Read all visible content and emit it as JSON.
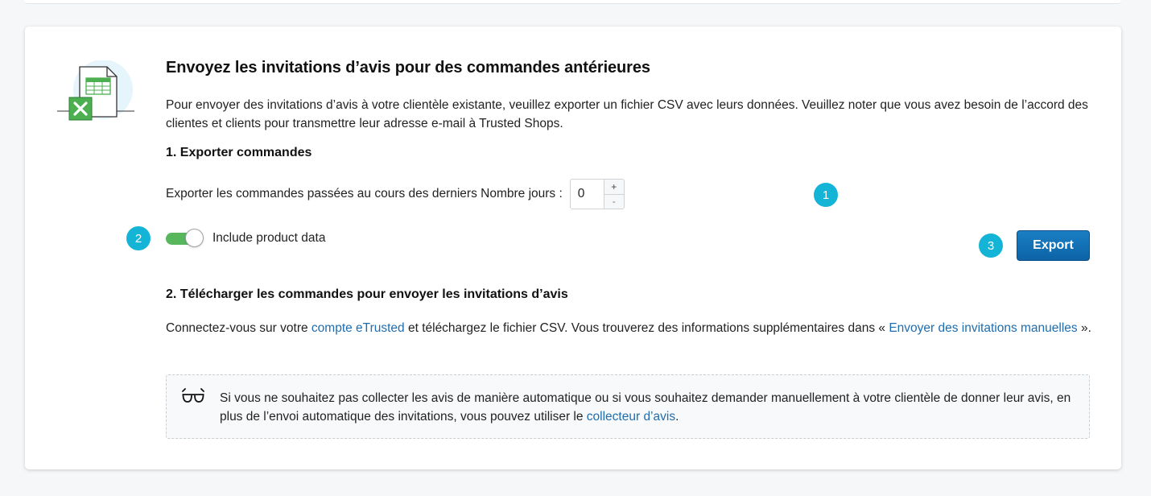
{
  "card": {
    "title": "Envoyez les invitations d’avis pour des commandes antérieures",
    "intro": "Pour envoyer des invitations d’avis à votre clientèle existante, veuillez exporter un fichier CSV avec leurs données. Veuillez noter que vous avez besoin de l’accord des clientes et clients pour transmettre leur adresse e-mail à Trusted Shops.",
    "illustration_icon": "excel-spreadsheet-icon"
  },
  "export_section": {
    "heading": "1. Exporter commandes",
    "days_label": "Exporter les commandes passées au cours des derniers Nombre jours :",
    "days_value": "0",
    "increment_label": "+",
    "decrement_label": "-",
    "toggle_label": "Include product data",
    "toggle_on": true,
    "export_label": "Export"
  },
  "badges": {
    "one": "1",
    "two": "2",
    "three": "3"
  },
  "download_section": {
    "heading": "2. Télécharger les commandes pour envoyer les invitations d’avis",
    "text_before": "Connectez-vous sur votre ",
    "link_account": "compte eTrusted",
    "text_middle": " et téléchargez le fichier CSV. Vous trouverez des informations supplémentaires dans « ",
    "link_manual": "Envoyer des invitations manuelles",
    "text_after": " »."
  },
  "info_box": {
    "icon": "glasses-icon",
    "text_before": "Si vous ne souhaitez pas collecter les avis de manière automatique ou si vous souhaitez demander manuellement à votre clientèle de donner leur avis, en plus de l’envoi automatique des invitations, vous pouvez utiliser le ",
    "link": "collecteur d’avis",
    "text_after": "."
  },
  "colors": {
    "accent_badge": "#14b4d6",
    "toggle_on": "#58b75d",
    "button_primary": "#0d63a6",
    "link": "#1f6dae",
    "excel_green": "#4caf50"
  }
}
